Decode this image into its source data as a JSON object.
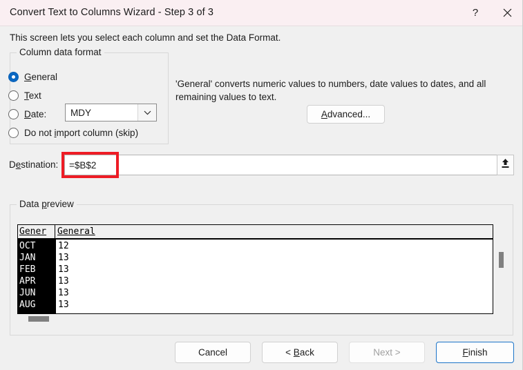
{
  "window": {
    "title": "Convert Text to Columns Wizard - Step 3 of 3",
    "help_icon": "question-mark-icon",
    "close_icon": "close-icon",
    "titlebar_color": "#faeff2",
    "body_color": "#f0f0f0"
  },
  "instruction": "This screen lets you select each column and set the Data Format.",
  "column_data_format": {
    "legend": "Column data format",
    "options": [
      {
        "label_before": "",
        "underlined": "G",
        "label_after": "eneral",
        "selected": true
      },
      {
        "label_before": "",
        "underlined": "T",
        "label_after": "ext",
        "selected": false
      },
      {
        "label_before": "",
        "underlined": "D",
        "label_after": "ate:",
        "selected": false
      },
      {
        "label_before": "Do not ",
        "underlined": "i",
        "label_after": "mport column (skip)",
        "selected": false
      }
    ],
    "date_format": {
      "value": "MDY",
      "arrow_icon": "chevron-down-icon"
    }
  },
  "description": "'General' converts numeric values to numbers, date values to dates, and all remaining values to text.",
  "advanced_button": {
    "underlined": "A",
    "label_after": "dvanced..."
  },
  "destination": {
    "label_before": "D",
    "underlined": "e",
    "label_after": "stination:",
    "value": "=$B$2",
    "highlight_color": "#ee1c25",
    "collapse_icon": "collapse-dialog-upload-icon"
  },
  "data_preview": {
    "legend_before": "Data ",
    "legend_underlined": "p",
    "legend_after": "review",
    "headers": [
      "Gener",
      "General"
    ],
    "rows": [
      {
        "col0": "OCT",
        "col1": "12"
      },
      {
        "col0": "JAN",
        "col1": "13"
      },
      {
        "col0": "FEB",
        "col1": "13"
      },
      {
        "col0": "APR",
        "col1": "13"
      },
      {
        "col0": "JUN",
        "col1": "13"
      },
      {
        "col0": "AUG",
        "col1": "13"
      }
    ],
    "selected_column_index": 0
  },
  "footer": {
    "cancel": "Cancel",
    "back_before": "< ",
    "back_underlined": "B",
    "back_after": "ack",
    "next": "Next >",
    "next_enabled": false,
    "finish_underlined": "F",
    "finish_after": "inish",
    "finish_is_default": true
  }
}
